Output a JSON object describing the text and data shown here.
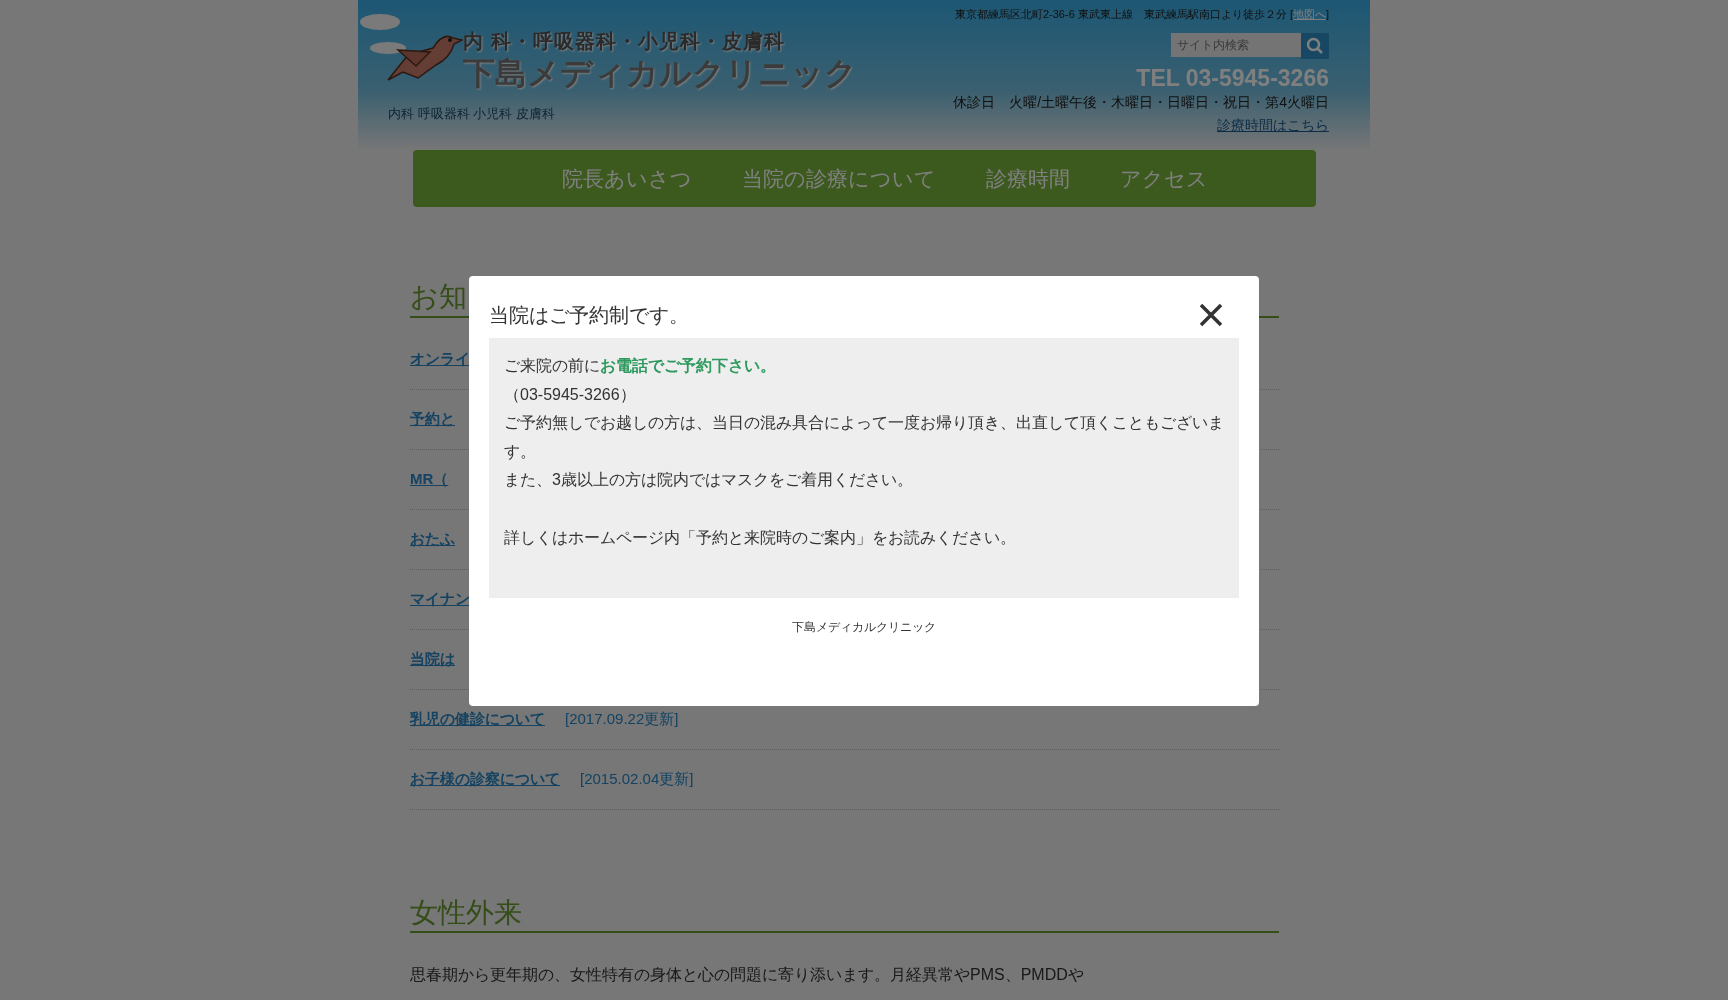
{
  "header": {
    "specialties": "内 科・呼吸器科・小児科・皮膚科",
    "clinic_name": "下島メディカルクリニック",
    "tagline": "内科 呼吸器科 小児科 皮膚科",
    "address": "東京都練馬区北町2-36-6 東武東上線　東武練馬駅南口より徒歩２分 [",
    "map_link": "地図へ",
    "address_end": "]",
    "search": {
      "placeholder": "サイト内検索"
    },
    "tel": "TEL 03-5945-3266",
    "closed_days": "休診日　火曜/土曜午後・木曜日・日曜日・祝日・第4火曜日",
    "hours_link": "診療時間はこちら"
  },
  "nav": [
    {
      "label": "院長あいさつ"
    },
    {
      "label": "当院の診療について"
    },
    {
      "label": "診療時間"
    },
    {
      "label": "アクセス"
    }
  ],
  "news": {
    "heading": "お知",
    "items": [
      {
        "title": "オンライ"
      },
      {
        "title": "予約と"
      },
      {
        "title": "MR（"
      },
      {
        "title": "おたふ"
      },
      {
        "title": "マイナン"
      },
      {
        "title": "当院は"
      },
      {
        "title": "乳児の健診について",
        "date": "[2017.09.22更新]"
      },
      {
        "title": "お子様の診察について",
        "date": "[2015.02.04更新]"
      }
    ]
  },
  "women": {
    "heading": "女性外来",
    "text": "思春期から更年期の、女性特有の身体と心の問題に寄り添います。月経異常やPMS、PMDDや"
  },
  "modal": {
    "title": "当院はご予約制です。",
    "paragraphs": [
      {
        "lines": [
          "ご来院の前に**お電話でご予約下さい。**",
          "（03-5945-3266）",
          "ご予約無しでお越しの方は、当日の混み具合によって一度お帰り頂き、出直して頂くこともございます。",
          "また、3歳以上の方は院内ではマスクをご着用ください。"
        ]
      },
      {
        "lines": [
          "詳しくはホームページ内「予約と来院時のご案内」をお読みください。"
        ]
      }
    ],
    "footer": "下島メディカルクリニック"
  }
}
